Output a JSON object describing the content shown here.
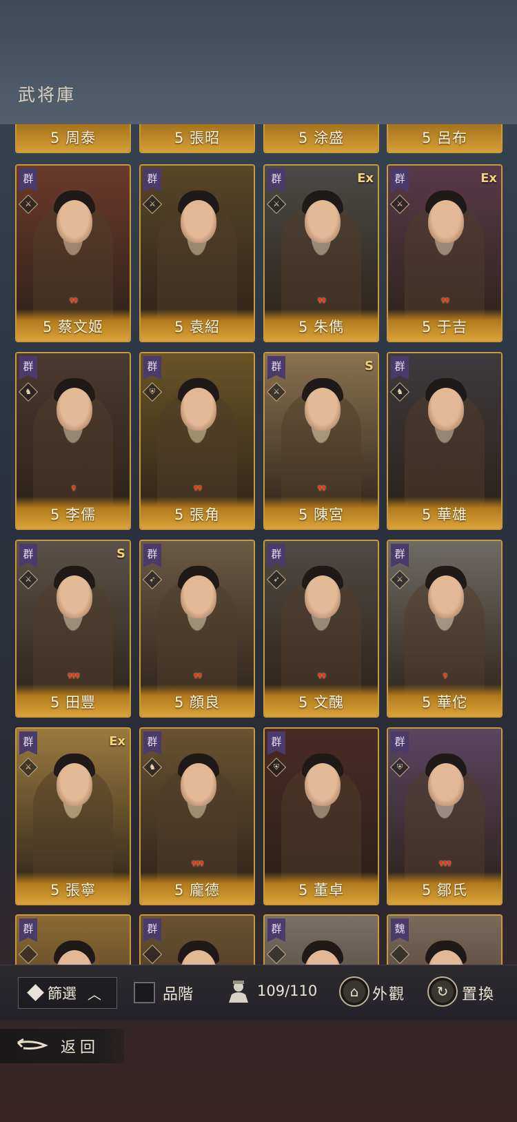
{
  "screen_title": "武将庫",
  "cards_partial_top": [
    {
      "level": "5",
      "name": "周泰"
    },
    {
      "level": "5",
      "name": "張昭"
    },
    {
      "level": "5",
      "name": "涂盛"
    },
    {
      "level": "5",
      "name": "呂布"
    }
  ],
  "cards": [
    {
      "level": "5",
      "name": "蔡文姬",
      "faction": "群",
      "awaken": "❜❜",
      "rank": "",
      "class_glyph": "⚔",
      "tone": "#6b3a2a"
    },
    {
      "level": "5",
      "name": "袁紹",
      "faction": "群",
      "awaken": "",
      "rank": "",
      "class_glyph": "⚔",
      "tone": "#5a4628"
    },
    {
      "level": "5",
      "name": "朱儁",
      "faction": "群",
      "awaken": "❜❜",
      "rank": "Ex",
      "class_glyph": "⚔",
      "tone": "#4b4a46"
    },
    {
      "level": "5",
      "name": "于吉",
      "faction": "群",
      "awaken": "❜❜",
      "rank": "Ex",
      "class_glyph": "⚔",
      "tone": "#5a3a4a"
    },
    {
      "level": "5",
      "name": "李儒",
      "faction": "群",
      "awaken": "❜",
      "rank": "",
      "class_glyph": "♞",
      "tone": "#4a3a30"
    },
    {
      "level": "5",
      "name": "張角",
      "faction": "群",
      "awaken": "❜❜",
      "rank": "",
      "class_glyph": "⛨",
      "tone": "#6a5426"
    },
    {
      "level": "5",
      "name": "陳宮",
      "faction": "群",
      "awaken": "❜❜",
      "rank": "S",
      "class_glyph": "⚔",
      "tone": "#8a7250"
    },
    {
      "level": "5",
      "name": "華雄",
      "faction": "群",
      "awaken": "",
      "rank": "",
      "class_glyph": "♞",
      "tone": "#3e3a3e"
    },
    {
      "level": "5",
      "name": "田豐",
      "faction": "群",
      "awaken": "❜❜❜",
      "rank": "S",
      "class_glyph": "⚔",
      "tone": "#5a5248"
    },
    {
      "level": "5",
      "name": "顔良",
      "faction": "群",
      "awaken": "❜❜",
      "rank": "",
      "class_glyph": "➶",
      "tone": "#6a5a44"
    },
    {
      "level": "5",
      "name": "文醜",
      "faction": "群",
      "awaken": "❜❜",
      "rank": "",
      "class_glyph": "➶",
      "tone": "#504a44"
    },
    {
      "level": "5",
      "name": "華佗",
      "faction": "群",
      "awaken": "❜",
      "rank": "",
      "class_glyph": "⚔",
      "tone": "#6e6a64"
    },
    {
      "level": "5",
      "name": "張寧",
      "faction": "群",
      "awaken": "",
      "rank": "Ex",
      "class_glyph": "⚔",
      "tone": "#9a7a3e"
    },
    {
      "level": "5",
      "name": "龐德",
      "faction": "群",
      "awaken": "❜❜❜",
      "rank": "",
      "class_glyph": "♞",
      "tone": "#6a5232"
    },
    {
      "level": "5",
      "name": "董卓",
      "faction": "群",
      "awaken": "",
      "rank": "",
      "class_glyph": "⛨",
      "tone": "#4a2a26"
    },
    {
      "level": "5",
      "name": "鄒氏",
      "faction": "群",
      "awaken": "❜❜❜",
      "rank": "",
      "class_glyph": "⛨",
      "tone": "#5a4660"
    }
  ],
  "cards_partial_bottom": [
    {
      "faction": "群",
      "tone": "#8a6a34"
    },
    {
      "faction": "群",
      "tone": "#6a5232"
    },
    {
      "faction": "群",
      "tone": "#7a7068"
    },
    {
      "faction": "魏",
      "tone": "#7a6a5a"
    }
  ],
  "toolbar": {
    "filter_label": "篩選",
    "grade_label": "品階",
    "count": "109/110",
    "appearance_label": "外觀",
    "swap_label": "置換"
  },
  "back_label": "返回"
}
